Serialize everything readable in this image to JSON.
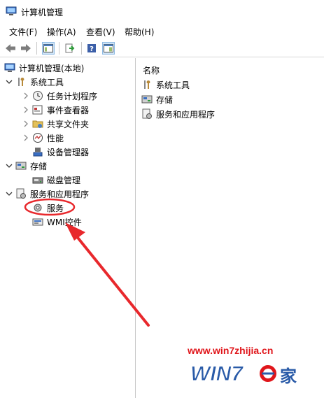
{
  "window": {
    "title": "计算机管理"
  },
  "menu": [
    {
      "label": "文件(F)"
    },
    {
      "label": "操作(A)"
    },
    {
      "label": "查看(V)"
    },
    {
      "label": "帮助(H)"
    }
  ],
  "toolbar": {
    "icons": [
      "back-icon",
      "forward-icon",
      "show-hide-tree-icon",
      "export-list-icon",
      "help-icon",
      "properties-icon"
    ]
  },
  "tree": {
    "root": "计算机管理(本地)",
    "system_tools": "系统工具",
    "task_scheduler": "任务计划程序",
    "event_viewer": "事件查看器",
    "shared_folders": "共享文件夹",
    "performance": "性能",
    "device_manager": "设备管理器",
    "storage": "存储",
    "disk_management": "磁盘管理",
    "services_apps": "服务和应用程序",
    "services": "服务",
    "wmi": "WMI控件"
  },
  "list": {
    "column_name": "名称",
    "items": [
      {
        "label": "系统工具",
        "icon": "tools-icon"
      },
      {
        "label": "存储",
        "icon": "storage-icon"
      },
      {
        "label": "服务和应用程序",
        "icon": "services-apps-icon"
      }
    ]
  },
  "annotation": {
    "color": "#e8282c"
  },
  "watermark": {
    "url": "www.win7zhijia.cn",
    "logo_text": "WIN7.之家"
  }
}
